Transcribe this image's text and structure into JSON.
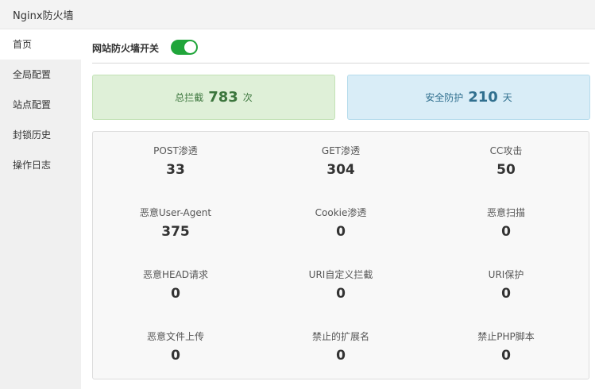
{
  "window": {
    "title": "Nginx防火墙"
  },
  "sidebar": {
    "items": [
      {
        "label": "首页"
      },
      {
        "label": "全局配置"
      },
      {
        "label": "站点配置"
      },
      {
        "label": "封锁历史"
      },
      {
        "label": "操作日志"
      }
    ]
  },
  "main": {
    "switch": {
      "label": "网站防火墙开关",
      "state": "on",
      "color": "#20a53a"
    },
    "summary": {
      "blocked": {
        "prefix": "总拦截",
        "value": "783",
        "unit": "次"
      },
      "protected": {
        "prefix": "安全防护",
        "value": "210",
        "unit": "天"
      }
    },
    "stats": [
      {
        "label": "POST渗透",
        "value": "33"
      },
      {
        "label": "GET渗透",
        "value": "304"
      },
      {
        "label": "CC攻击",
        "value": "50"
      },
      {
        "label": "恶意User-Agent",
        "value": "375"
      },
      {
        "label": "Cookie渗透",
        "value": "0"
      },
      {
        "label": "恶意扫描",
        "value": "0"
      },
      {
        "label": "恶意HEAD请求",
        "value": "0"
      },
      {
        "label": "URI自定义拦截",
        "value": "0"
      },
      {
        "label": "URI保护",
        "value": "0"
      },
      {
        "label": "恶意文件上传",
        "value": "0"
      },
      {
        "label": "禁止的扩展名",
        "value": "0"
      },
      {
        "label": "禁止PHP脚本",
        "value": "0"
      }
    ]
  }
}
